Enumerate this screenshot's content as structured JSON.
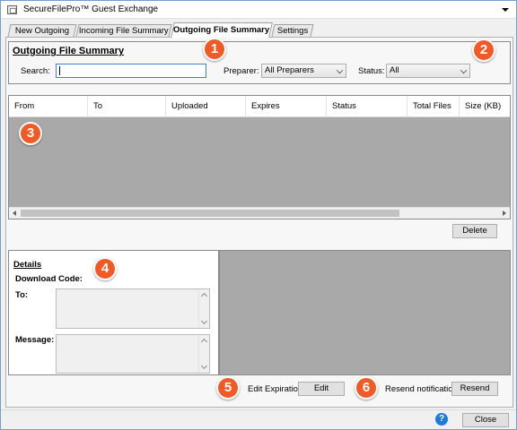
{
  "window": {
    "title": "SecureFilePro™ Guest Exchange",
    "app_icon": "window-icon",
    "menu_icon": "dropdown-arrow-icon"
  },
  "tabs": [
    {
      "label": "New Outgoing"
    },
    {
      "label": "Incoming File Summary"
    },
    {
      "label": "Outgoing File Summary",
      "active": true
    },
    {
      "label": "Settings"
    }
  ],
  "summary": {
    "title": "Outgoing File Summary",
    "search_label": "Search:",
    "search_value": "",
    "preparer_label": "Preparer:",
    "preparer_value": "All Preparers",
    "status_label": "Status:",
    "status_value": "All"
  },
  "grid": {
    "columns": [
      "From",
      "To",
      "Uploaded",
      "Expires",
      "Status",
      "Total Files",
      "Size (KB)"
    ],
    "rows": []
  },
  "buttons": {
    "delete": "Delete",
    "edit": "Edit",
    "resend": "Resend",
    "close": "Close"
  },
  "details": {
    "title": "Details",
    "download_code_label": "Download Code:",
    "download_code_value": "",
    "to_label": "To:",
    "message_label": "Message:"
  },
  "actions": {
    "edit_expiration_label": "Edit Expiration",
    "resend_notification_label": "Resend notification"
  },
  "callouts": [
    "1",
    "2",
    "3",
    "4",
    "5",
    "6"
  ],
  "colors": {
    "callout": "#f15a24",
    "grid_background": "#a9a9a9",
    "search_focus_border": "#3f7fd8",
    "help_icon": "#1e7ad6"
  }
}
